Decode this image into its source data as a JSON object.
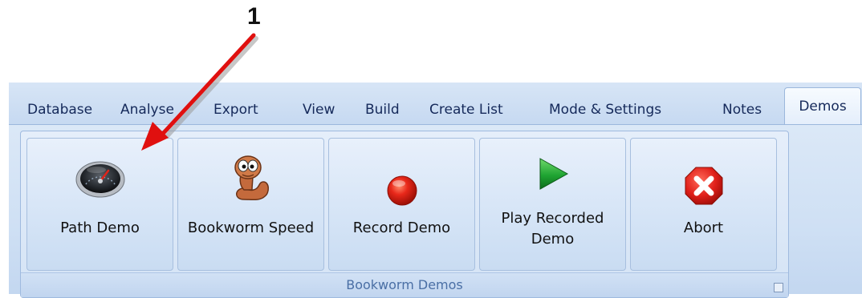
{
  "annotation": {
    "callout_number": "1"
  },
  "ribbon": {
    "tabs": [
      {
        "label": "Database"
      },
      {
        "label": "Analyse"
      },
      {
        "label": "Export"
      },
      {
        "label": "View"
      },
      {
        "label": "Build"
      },
      {
        "label": "Create List"
      },
      {
        "label": "Mode & Settings"
      },
      {
        "label": "Notes"
      },
      {
        "label": "Demos",
        "active": true
      }
    ],
    "group": {
      "title": "Bookworm Demos",
      "buttons": [
        {
          "label": "Path Demo",
          "icon": "speedometer-icon"
        },
        {
          "label": "Bookworm Speed",
          "icon": "bookworm-icon"
        },
        {
          "label": "Record Demo",
          "icon": "record-icon"
        },
        {
          "label_line1": "Play Recorded",
          "label_line2": "Demo",
          "icon": "play-icon"
        },
        {
          "label": "Abort",
          "icon": "abort-icon"
        }
      ]
    }
  },
  "colors": {
    "tab_text": "#15295a",
    "group_title_text": "#4a6fa5",
    "annotation_arrow": "#e0100f"
  }
}
